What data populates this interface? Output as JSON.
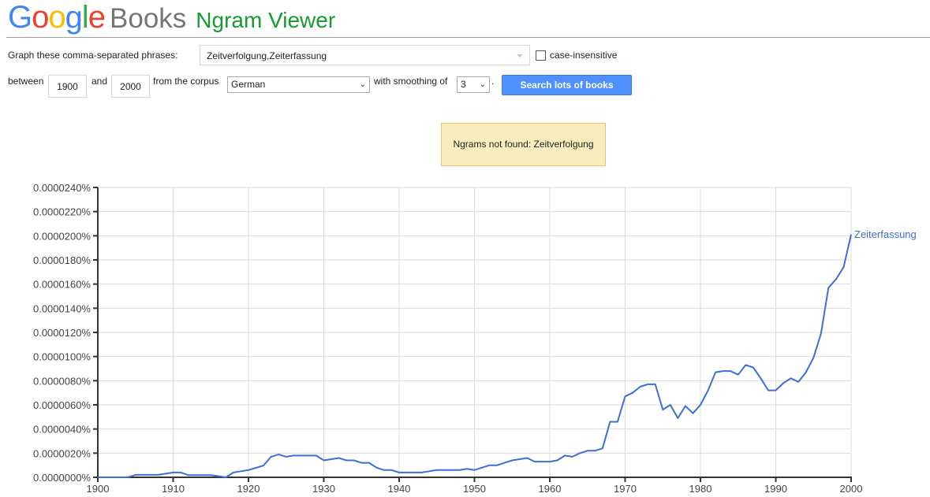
{
  "header": {
    "logo_google": [
      "G",
      "o",
      "o",
      "g",
      "l",
      "e"
    ],
    "logo_google_colors": [
      "#4285f4",
      "#ea4335",
      "#fbbc05",
      "#4285f4",
      "#34a853",
      "#ea4335"
    ],
    "logo_books": "Books",
    "app_title": "Ngram Viewer"
  },
  "form": {
    "phrases_label": "Graph these comma-separated phrases:",
    "phrases_value": "Zeitverfolgung,Zeiterfassung",
    "case_insensitive_label": "case-insensitive",
    "case_insensitive_checked": false,
    "between_label": "between",
    "start_year": "1900",
    "and_label": "and",
    "end_year": "2000",
    "corpus_label": "from the corpus",
    "corpus_value": "German",
    "smoothing_label": "with smoothing of",
    "smoothing_value": "3",
    "period": ".",
    "search_button": "Search lots of books"
  },
  "notice": {
    "text": "Ngrams not found: Zeitverfolgung"
  },
  "chart_data": {
    "type": "line",
    "title": "",
    "xlabel": "",
    "ylabel": "",
    "xlim": [
      1900,
      2000
    ],
    "ylim": [
      0,
      2.4e-05
    ],
    "x_ticks": [
      "1900",
      "1910",
      "1920",
      "1930",
      "1940",
      "1950",
      "1960",
      "1970",
      "1980",
      "1990",
      "2000"
    ],
    "y_ticks": [
      "0.0000000%",
      "0.0000020%",
      "0.0000040%",
      "0.0000060%",
      "0.0000080%",
      "0.0000100%",
      "0.0000120%",
      "0.0000140%",
      "0.0000160%",
      "0.0000180%",
      "0.0000200%",
      "0.0000220%",
      "0.0000240%"
    ],
    "y_unit": "%",
    "grid": true,
    "legend": "end-of-line label",
    "series": [
      {
        "name": "Zeiterfassung",
        "color": "#3b6fd4",
        "x": [
          1900,
          1901,
          1902,
          1903,
          1904,
          1905,
          1906,
          1907,
          1908,
          1909,
          1910,
          1911,
          1912,
          1913,
          1914,
          1915,
          1916,
          1917,
          1918,
          1919,
          1920,
          1921,
          1922,
          1923,
          1924,
          1925,
          1926,
          1927,
          1928,
          1929,
          1930,
          1931,
          1932,
          1933,
          1934,
          1935,
          1936,
          1937,
          1938,
          1939,
          1940,
          1941,
          1942,
          1943,
          1944,
          1945,
          1946,
          1947,
          1948,
          1949,
          1950,
          1951,
          1952,
          1953,
          1954,
          1955,
          1956,
          1957,
          1958,
          1959,
          1960,
          1961,
          1962,
          1963,
          1964,
          1965,
          1966,
          1967,
          1968,
          1969,
          1970,
          1971,
          1972,
          1973,
          1974,
          1975,
          1976,
          1977,
          1978,
          1979,
          1980,
          1981,
          1982,
          1983,
          1984,
          1985,
          1986,
          1987,
          1988,
          1989,
          1990,
          1991,
          1992,
          1993,
          1994,
          1995,
          1996,
          1997,
          1998,
          1999,
          2000
        ],
        "values": [
          0,
          0,
          0,
          0,
          0,
          2e-07,
          2e-07,
          2e-07,
          2e-07,
          3e-07,
          4e-07,
          4e-07,
          1.8e-07,
          1.8e-07,
          1.8e-07,
          1.8e-07,
          1e-07,
          0,
          4e-07,
          5e-07,
          6e-07,
          7.8e-07,
          9.8e-07,
          1.7e-06,
          1.9e-06,
          1.7e-06,
          1.8e-06,
          1.8e-06,
          1.8e-06,
          1.8e-06,
          1.4e-06,
          1.5e-06,
          1.6e-06,
          1.4e-06,
          1.4e-06,
          1.2e-06,
          1.2e-06,
          8e-07,
          6e-07,
          6e-07,
          4e-07,
          4e-07,
          4e-07,
          4e-07,
          5e-07,
          6e-07,
          6e-07,
          6e-07,
          6e-07,
          7e-07,
          6e-07,
          8e-07,
          1e-06,
          1e-06,
          1.2e-06,
          1.4e-06,
          1.5e-06,
          1.6e-06,
          1.3e-06,
          1.3e-06,
          1.3e-06,
          1.4e-06,
          1.8e-06,
          1.7e-06,
          2e-06,
          2.2e-06,
          2.2e-06,
          2.4e-06,
          4.6e-06,
          4.6e-06,
          6.7e-06,
          7e-06,
          7.5e-06,
          7.7e-06,
          7.7e-06,
          5.6e-06,
          6e-06,
          4.9e-06,
          5.9e-06,
          5.3e-06,
          6e-06,
          7.2e-06,
          8.7e-06,
          8.8e-06,
          8.8e-06,
          8.5e-06,
          9.3e-06,
          9.1e-06,
          8.2e-06,
          7.2e-06,
          7.2e-06,
          7.8e-06,
          8.2e-06,
          7.9e-06,
          8.7e-06,
          9.9e-06,
          1.19e-05,
          1.57e-05,
          1.64e-05,
          1.74e-05,
          2.01e-05
        ]
      }
    ]
  }
}
